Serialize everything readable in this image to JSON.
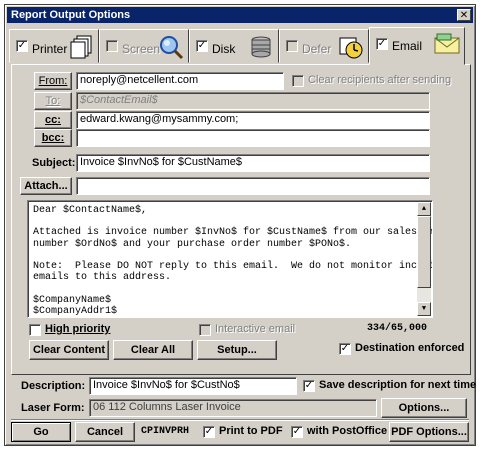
{
  "window": {
    "title": "Report Output Options",
    "close_glyph": "✕"
  },
  "tabs": [
    {
      "label": "Printer",
      "checked": true,
      "enabled": true,
      "icon": "printer-copies-icon"
    },
    {
      "label": "Screen",
      "checked": false,
      "enabled": false,
      "icon": "magnifier-icon"
    },
    {
      "label": "Disk",
      "checked": true,
      "enabled": true,
      "icon": "disk-stack-icon"
    },
    {
      "label": "Defer",
      "checked": false,
      "enabled": false,
      "icon": "clock-icon"
    },
    {
      "label": "Email",
      "checked": true,
      "enabled": true,
      "active": true,
      "icon": "envelope-icon"
    }
  ],
  "email": {
    "from_label": "From:",
    "from_value": "noreply@netcellent.com",
    "clear_recipients_label": "Clear recipients after sending",
    "to_label": "To:",
    "to_value": "$ContactEmail$",
    "cc_label": "cc:",
    "cc_value": "edward.kwang@mysammy.com;",
    "bcc_label": "bcc:",
    "bcc_value": "",
    "subject_label": "Subject:",
    "subject_value": "Invoice $InvNo$ for $CustName$",
    "attach_label": "Attach...",
    "attach_value": "",
    "body_lines": [
      "Dear $ContactName$,",
      "",
      "Attached is invoice number $InvNo$ for $CustName$ from our sales order",
      "number $OrdNo$ and your purchase order number $PONo$.",
      "",
      "Note:  Please DO NOT reply to this email.  We do not monitor incoming",
      "emails to this address.",
      "",
      "$CompanyName$",
      "$CompanyAddr1$"
    ],
    "high_priority_label": "High priority",
    "interactive_email_label": "Interactive email",
    "char_count": "334/65,000",
    "clear_content_label": "Clear Content",
    "clear_all_label": "Clear All",
    "setup_label": "Setup...",
    "destination_enforced_label": "Destination enforced"
  },
  "footer": {
    "description_label": "Description:",
    "description_value": "Invoice $InvNo$ for $CustNo$",
    "save_description_label": "Save description for next time",
    "laser_form_label": "Laser Form:",
    "laser_form_value": "06 112 Columns Laser Invoice",
    "options_label": "Options...",
    "go_label": "Go",
    "cancel_label": "Cancel",
    "program_code": "CPINVPRH",
    "print_to_pdf_label": "Print to PDF",
    "with_postoffice_label": "with PostOffice",
    "pdf_options_label": "PDF Options..."
  },
  "check_glyph": "✓",
  "colors": {
    "titlebar": "#0a246a",
    "face": "#d4d0c8"
  }
}
